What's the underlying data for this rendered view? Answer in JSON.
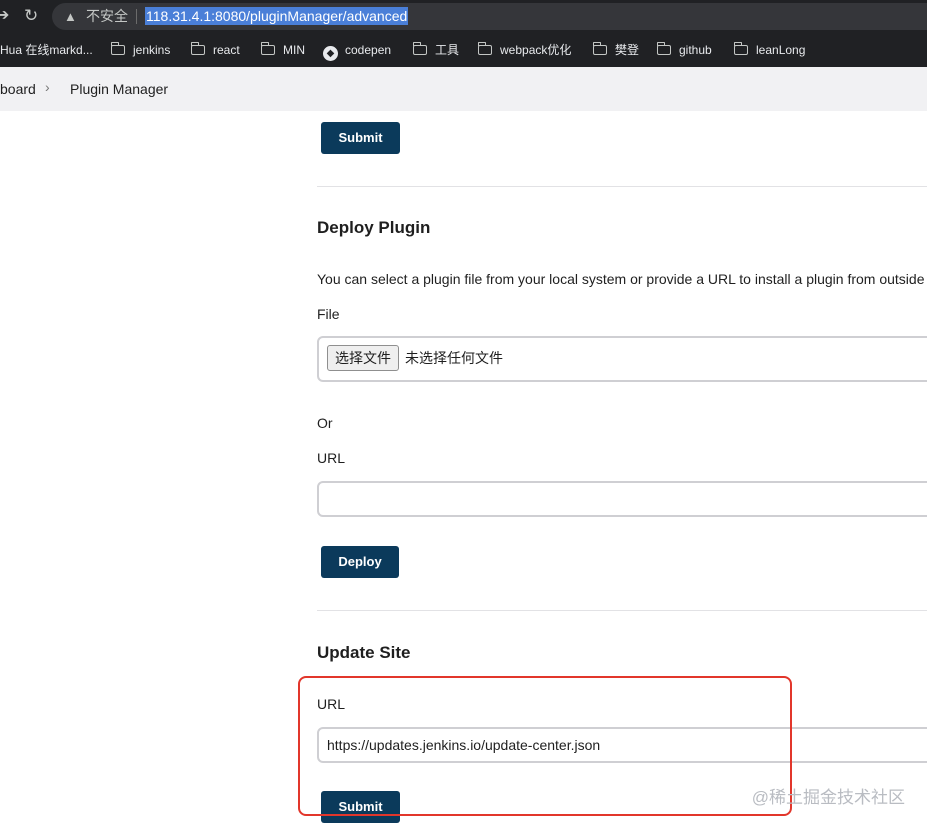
{
  "browser": {
    "insecure_label": "不安全",
    "url": "118.31.4.1:8080/pluginManager/advanced",
    "bookmarks": [
      {
        "label": "Hua 在线markd...",
        "icon": "none"
      },
      {
        "label": "jenkins",
        "icon": "folder-icon"
      },
      {
        "label": "react",
        "icon": "folder-icon"
      },
      {
        "label": "MIN",
        "icon": "folder-icon"
      },
      {
        "label": "codepen",
        "icon": "codepen-icon"
      },
      {
        "label": "工具",
        "icon": "folder-icon"
      },
      {
        "label": "webpack优化",
        "icon": "folder-icon"
      },
      {
        "label": "樊登",
        "icon": "folder-icon"
      },
      {
        "label": "github",
        "icon": "folder-icon"
      },
      {
        "label": "leanLong",
        "icon": "folder-icon"
      }
    ]
  },
  "breadcrumb": {
    "items": [
      "board",
      "Plugin Manager"
    ]
  },
  "top_section": {
    "submit_label": "Submit"
  },
  "deploy": {
    "title": "Deploy Plugin",
    "description": "You can select a plugin file from your local system or provide a URL to install a plugin from outside t",
    "file_label": "File",
    "file_button": "选择文件",
    "file_status": "未选择任何文件",
    "or_label": "Or",
    "url_label": "URL",
    "url_value": "",
    "deploy_label": "Deploy"
  },
  "update_site": {
    "title": "Update Site",
    "url_label": "URL",
    "url_value": "https://updates.jenkins.io/update-center.json",
    "submit_label": "Submit"
  },
  "watermark": "@稀土掘金技术社区",
  "colors": {
    "primary_button": "#0b3a5b",
    "highlight": "#e2362b"
  }
}
